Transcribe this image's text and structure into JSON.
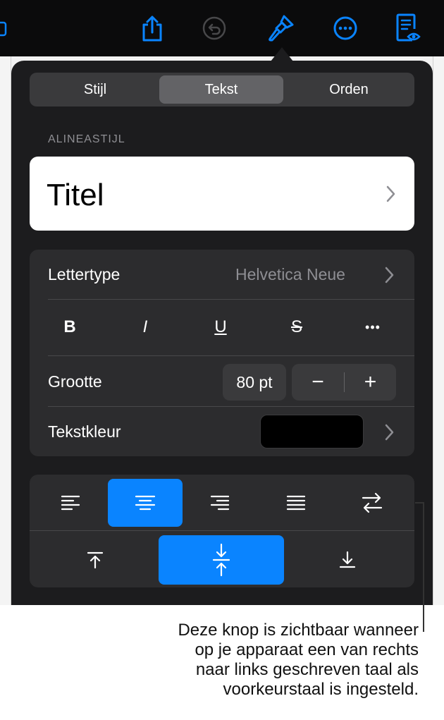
{
  "tabs": [
    {
      "label": "Stijl",
      "active": false
    },
    {
      "label": "Tekst",
      "active": true
    },
    {
      "label": "Orden",
      "active": false
    }
  ],
  "section_title": "ALINEASTIJL",
  "paragraph_style": "Titel",
  "font": {
    "label": "Lettertype",
    "value": "Helvetica Neue"
  },
  "format_buttons": [
    {
      "label": "B",
      "name": "bold"
    },
    {
      "label": "I",
      "name": "italic"
    },
    {
      "label": "U",
      "name": "underline"
    },
    {
      "label": "S",
      "name": "strikethrough"
    },
    {
      "label": "•••",
      "name": "more"
    }
  ],
  "size": {
    "label": "Grootte",
    "value": "80 pt",
    "decrement": "−",
    "increment": "+"
  },
  "text_color": {
    "label": "Tekstkleur",
    "color": "#000000"
  },
  "alignment": {
    "selected_horizontal": "center",
    "selected_vertical": "middle"
  },
  "callout_lines": [
    "Deze knop is zichtbaar wanneer",
    "op je apparaat een van rechts",
    "naar links geschreven taal als",
    "voorkeurstaal is ingesteld."
  ],
  "colors": {
    "accent": "#0a84ff",
    "toolbar_icons": "#0a84ff",
    "panel": "#1c1c1e"
  }
}
